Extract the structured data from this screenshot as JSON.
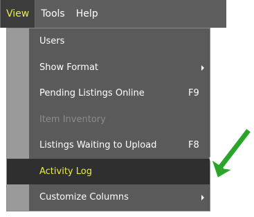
{
  "menubar": {
    "items": [
      {
        "label": "View",
        "active": true
      },
      {
        "label": "Tools",
        "active": false
      },
      {
        "label": "Help",
        "active": false
      }
    ]
  },
  "view_menu": {
    "items": [
      {
        "label": "Users",
        "shortcut": "",
        "submenu": false,
        "disabled": false,
        "highlighted": false
      },
      {
        "label": "Show Format",
        "shortcut": "",
        "submenu": true,
        "disabled": false,
        "highlighted": false
      },
      {
        "label": "Pending Listings Online",
        "shortcut": "F9",
        "submenu": false,
        "disabled": false,
        "highlighted": false
      },
      {
        "label": "Item Inventory",
        "shortcut": "",
        "submenu": false,
        "disabled": true,
        "highlighted": false
      },
      {
        "label": "Listings Waiting to Upload",
        "shortcut": "F8",
        "submenu": false,
        "disabled": false,
        "highlighted": false
      },
      {
        "label": "Activity Log",
        "shortcut": "",
        "submenu": false,
        "disabled": false,
        "highlighted": true
      },
      {
        "label": "Customize Columns",
        "shortcut": "",
        "submenu": true,
        "disabled": false,
        "highlighted": false
      }
    ]
  },
  "colors": {
    "menubar_bg": "#5e5e5e",
    "menu_bg": "#5a5a5a",
    "highlight_bg": "#2f2f2f",
    "highlight_text": "#e7ed4a",
    "pointer_arrow": "#2aa52a"
  },
  "icons": {
    "pointer": "green-arrow-icon",
    "submenu": "chevron-right-icon"
  }
}
